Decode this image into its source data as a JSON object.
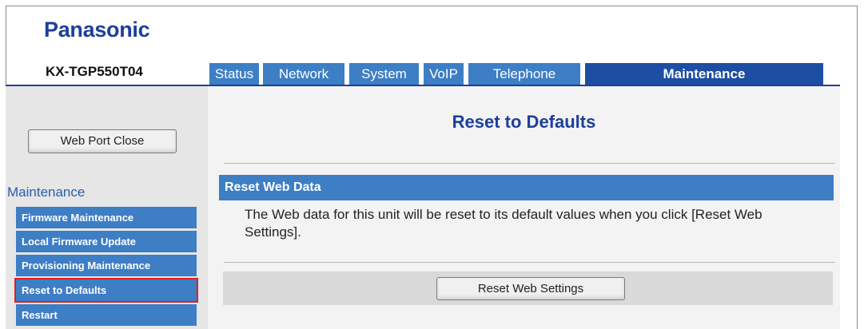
{
  "brand": {
    "logo": "Panasonic",
    "model": "KX-TGP550T04"
  },
  "tabs": [
    {
      "label": "Status",
      "active": false
    },
    {
      "label": "Network",
      "active": false
    },
    {
      "label": "System",
      "active": false
    },
    {
      "label": "VoIP",
      "active": false
    },
    {
      "label": "Telephone",
      "active": false
    },
    {
      "label": "Maintenance",
      "active": true
    }
  ],
  "sidebar": {
    "web_port_close_label": "Web Port Close",
    "section_title": "Maintenance",
    "items": [
      {
        "label": "Firmware Maintenance",
        "selected": false
      },
      {
        "label": "Local Firmware Update",
        "selected": false
      },
      {
        "label": "Provisioning Maintenance",
        "selected": false
      },
      {
        "label": "Reset to Defaults",
        "selected": true
      },
      {
        "label": "Restart",
        "selected": false
      }
    ]
  },
  "main": {
    "page_title": "Reset to Defaults",
    "section_heading": "Reset Web Data",
    "description": "The Web data for this unit will be reset to its default values when you click [Reset Web Settings].",
    "reset_button_label": "Reset Web Settings"
  },
  "colors": {
    "brand_blue": "#1e3f9a",
    "tab_blue": "#3d7ec5",
    "active_tab_blue": "#1d4ea3",
    "highlight_red": "#e02020"
  }
}
